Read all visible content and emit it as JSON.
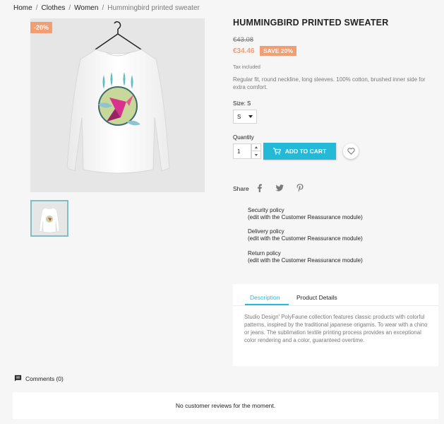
{
  "breadcrumb": {
    "items": [
      "Home",
      "Clothes",
      "Women",
      "Hummingbird printed sweater"
    ],
    "separator": "/"
  },
  "product": {
    "discount_badge": "-20%",
    "title": "HUMMINGBIRD PRINTED SWEATER",
    "old_price": "€43.08",
    "new_price": "€34.46",
    "save_badge": "SAVE 20%",
    "tax_note": "Tax included",
    "short_description": "Regular fit, round neckline, long sleeves. 100% cotton, brushed inner side for extra comfort.",
    "size_label": "Size: S",
    "size_value": "S",
    "quantity_label": "Quantity",
    "quantity_value": "1",
    "add_to_cart": "ADD TO CART",
    "share_label": "Share"
  },
  "reassurance": [
    {
      "title": "Security policy",
      "note": "(edit with the Customer Reassurance module)"
    },
    {
      "title": "Delivery policy",
      "note": "(edit with the Customer Reassurance module)"
    },
    {
      "title": "Return policy",
      "note": "(edit with the Customer Reassurance module)"
    }
  ],
  "tabs": {
    "description_label": "Description",
    "details_label": "Product Details",
    "description_text": "Studio Design' PolyFaune collection features classic products with colorful patterns, inspired by the traditional japanese origamis. To wear with a chino or jeans. The sublimation textile printing process provides an exceptional color rendering and a color, guaranteed overtime."
  },
  "comments": {
    "heading": "Comments (0)",
    "empty_message": "No customer reviews for the moment."
  },
  "colors": {
    "accent": "#24b9d7",
    "discount": "#f39d72",
    "background": "#f6f6f6"
  }
}
